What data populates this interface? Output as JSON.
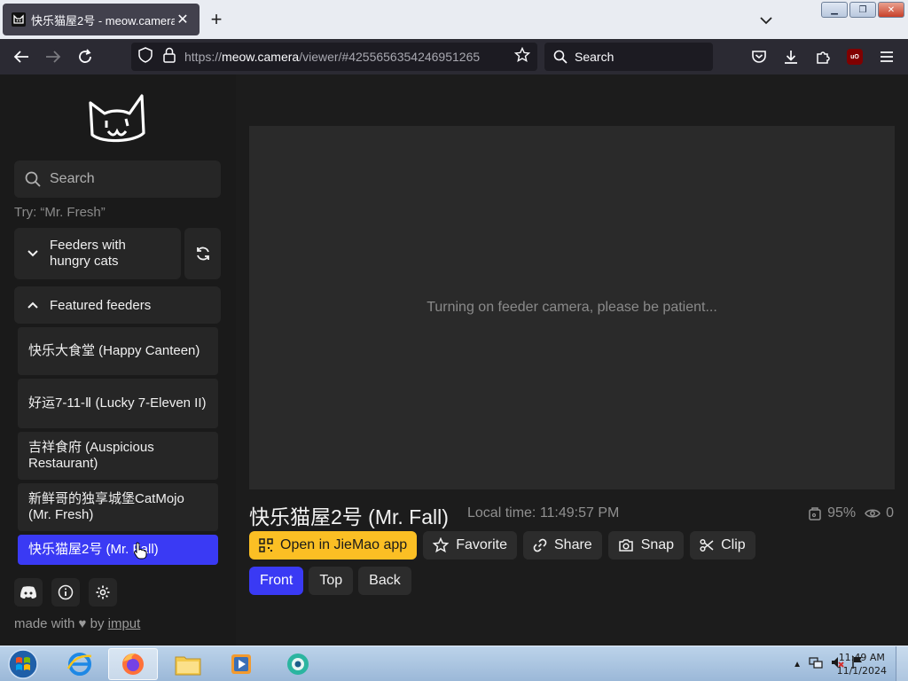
{
  "browser": {
    "tab": {
      "title": "快乐猫屋2号 - meow.camera"
    },
    "url": {
      "prefix": "https://",
      "host": "meow.camera",
      "path": "/viewer/#4255656354246951265"
    },
    "search_placeholder": "Search",
    "ublock_label": "uO"
  },
  "sidebar": {
    "search_placeholder": "Search",
    "try_hint": "Try: “Mr. Fresh”",
    "hungry_label": "Feeders with hungry cats",
    "featured_label": "Featured feeders",
    "feeders": [
      {
        "label": "快乐大食堂 (Happy Canteen)"
      },
      {
        "label": "好运7-11-Ⅱ (Lucky 7-Eleven II)"
      },
      {
        "label": "吉祥食府 (Auspicious Restaurant)"
      },
      {
        "label": "新鲜哥的独享城堡CatMojo (Mr. Fresh)"
      },
      {
        "label": "快乐猫屋2号 (Mr. Fall)",
        "active": true
      }
    ],
    "footer": {
      "made_with": "made with",
      "by": "by",
      "author": "imput"
    }
  },
  "main": {
    "status_message": "Turning on feeder camera, please be patient...",
    "feeder_title": "快乐猫屋2号 (Mr. Fall)",
    "local_time": "Local time: 11:49:57 PM",
    "food_level": "95%",
    "viewers": "0",
    "actions": {
      "open_app": "Open in JieMao app",
      "favorite": "Favorite",
      "share": "Share",
      "snap": "Snap",
      "clip": "Clip"
    },
    "views": {
      "front": "Front",
      "top": "Top",
      "back": "Back",
      "selected": "Front"
    }
  },
  "taskbar": {
    "time": "11:49 AM",
    "date": "11/1/2024"
  },
  "colors": {
    "accent": "#3a3af4",
    "app_button": "#fbbf24",
    "sidebar_bg": "#1a1a1a",
    "panel_bg": "#262626"
  }
}
